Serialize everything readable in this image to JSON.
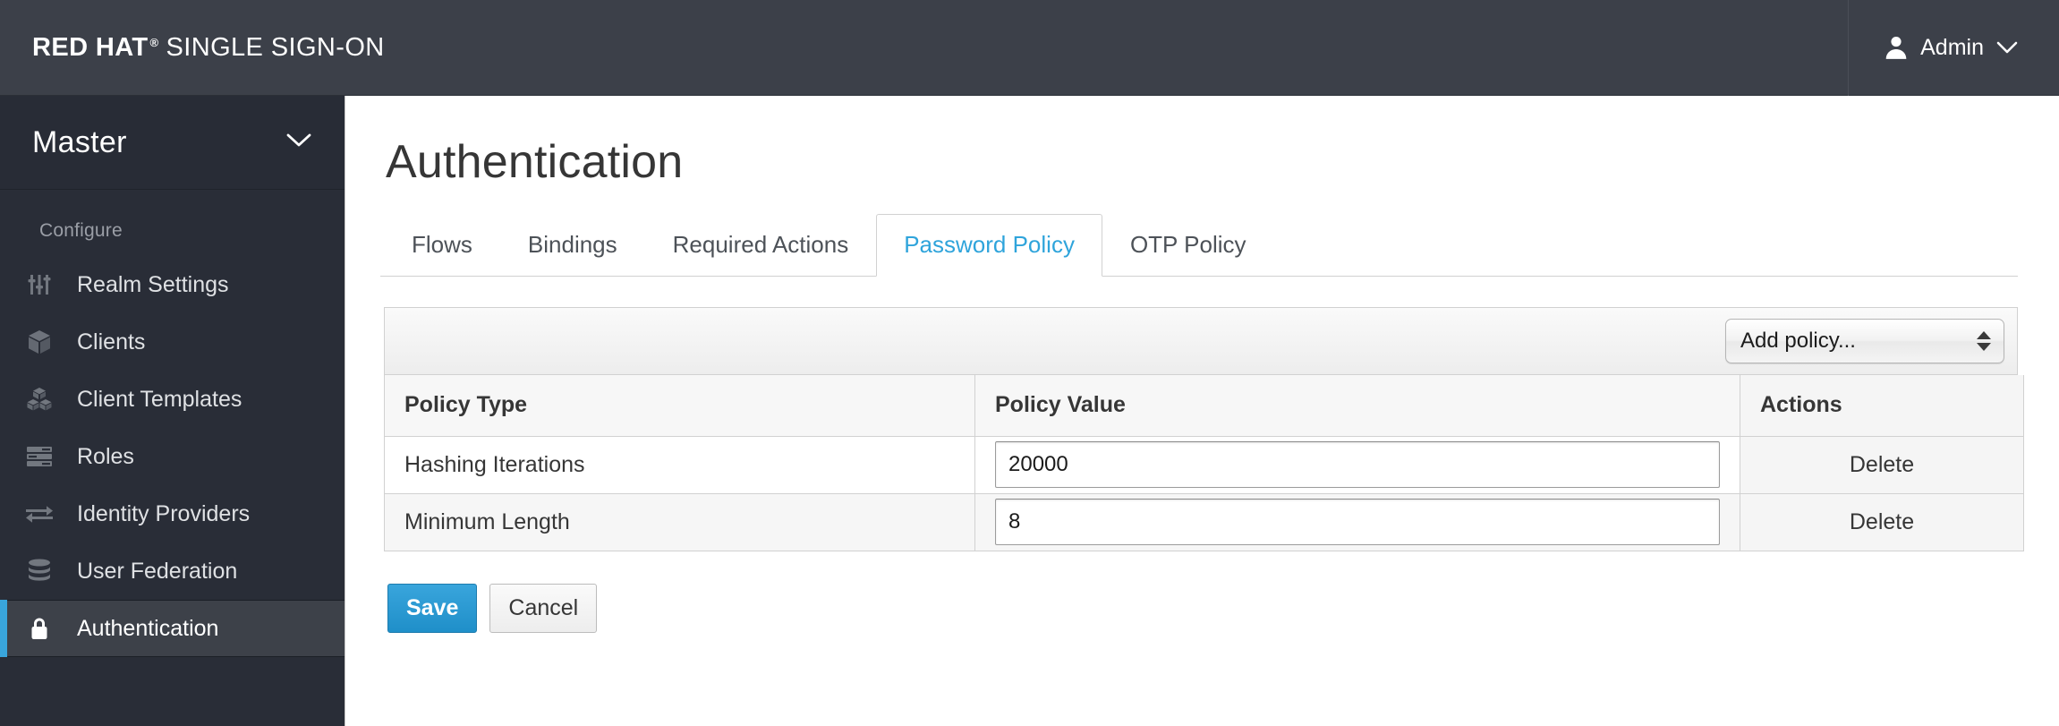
{
  "header": {
    "brand_bold": "RED HAT",
    "brand_mark": "®",
    "brand_regular": "SINGLE SIGN-ON",
    "user_icon": "user-icon",
    "user_label": "Admin",
    "user_caret_icon": "chevron-down-icon"
  },
  "sidebar": {
    "realm": {
      "name": "Master",
      "caret_icon": "chevron-down-icon"
    },
    "section_title": "Configure",
    "items": [
      {
        "label": "Realm Settings",
        "icon": "sliders-icon",
        "active": false
      },
      {
        "label": "Clients",
        "icon": "cube-icon",
        "active": false
      },
      {
        "label": "Client Templates",
        "icon": "stacked-cubes-icon",
        "active": false
      },
      {
        "label": "Roles",
        "icon": "list-bars-icon",
        "active": false
      },
      {
        "label": "Identity Providers",
        "icon": "exchange-arrows-icon",
        "active": false
      },
      {
        "label": "User Federation",
        "icon": "database-icon",
        "active": false
      },
      {
        "label": "Authentication",
        "icon": "lock-icon",
        "active": true
      }
    ],
    "active_accent_color": "#39a5dc"
  },
  "main": {
    "page_title": "Authentication",
    "tabs": [
      {
        "label": "Flows",
        "active": false
      },
      {
        "label": "Bindings",
        "active": false
      },
      {
        "label": "Required Actions",
        "active": false
      },
      {
        "label": "Password Policy",
        "active": true
      },
      {
        "label": "OTP Policy",
        "active": false
      }
    ],
    "toolbar": {
      "add_policy_label": "Add policy...",
      "add_policy_options": [
        "Add policy..."
      ]
    },
    "table": {
      "columns": [
        "Policy Type",
        "Policy Value",
        "Actions"
      ],
      "rows": [
        {
          "policy_type": "Hashing Iterations",
          "policy_value": "20000",
          "action_label": "Delete"
        },
        {
          "policy_type": "Minimum Length",
          "policy_value": "8",
          "action_label": "Delete"
        }
      ]
    },
    "buttons": {
      "save_label": "Save",
      "cancel_label": "Cancel"
    }
  },
  "colors": {
    "header_bg": "#3c4049",
    "sidebar_bg": "#292d37",
    "accent_blue": "#39a5dc",
    "active_tab_text": "#2fa4db",
    "primary_button": "#1f8fc9"
  }
}
